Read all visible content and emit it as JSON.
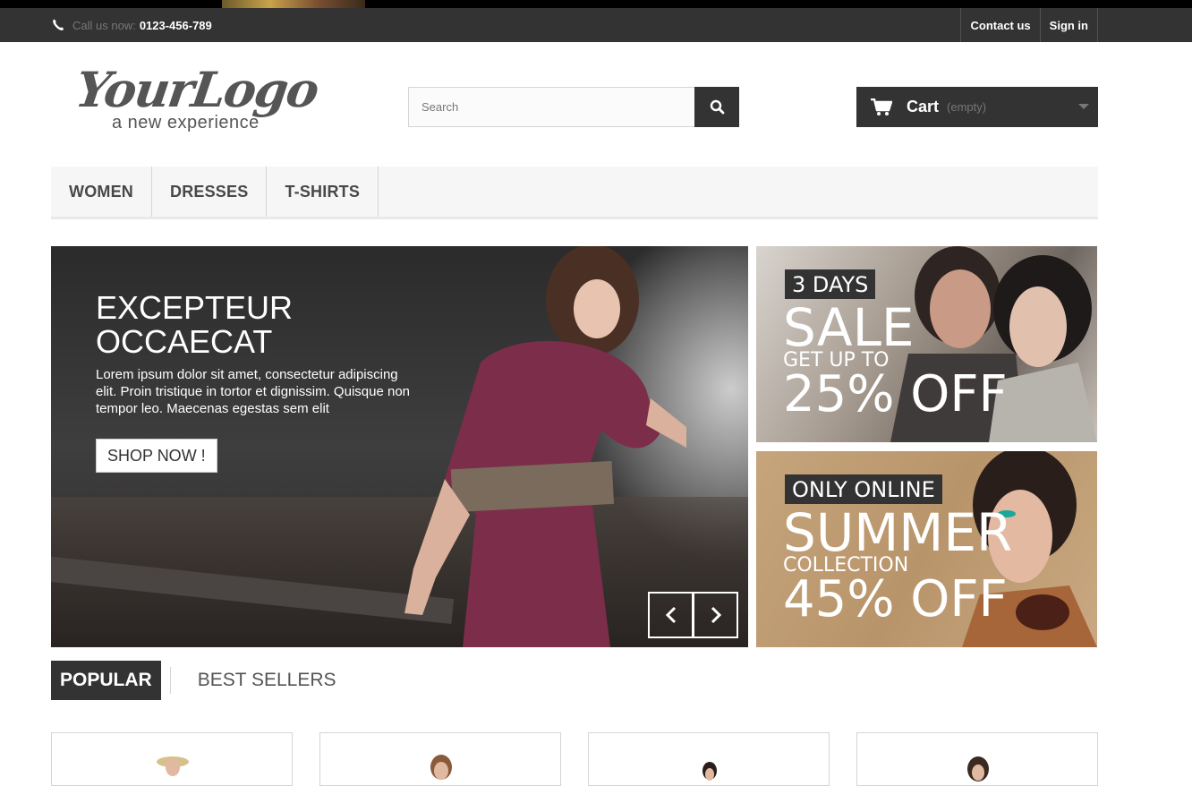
{
  "topbar": {
    "call_label": "Call us now:",
    "phone": "0123-456-789",
    "links": [
      "Contact us",
      "Sign in"
    ]
  },
  "logo": {
    "script": "YourLogo",
    "tagline": "a new experience"
  },
  "search": {
    "placeholder": "Search"
  },
  "cart": {
    "label": "Cart",
    "status": "(empty)"
  },
  "menu": {
    "items": [
      "WOMEN",
      "DRESSES",
      "T-SHIRTS"
    ]
  },
  "slider": {
    "title_line1": "EXCEPTEUR",
    "title_line2": "OCCAECAT",
    "text": "Lorem ipsum dolor sit amet, consectetur adipiscing elit. Proin tristique in tortor et dignissim. Quisque non tempor leo. Maecenas egestas sem elit",
    "button": "SHOP NOW !"
  },
  "promos": [
    {
      "tag": "3 DAYS",
      "big": "SALE",
      "mid": "GET UP TO",
      "off": "25% OFF"
    },
    {
      "tag": "ONLY ONLINE",
      "big": "SUMMER",
      "mid": "COLLECTION",
      "off": "45% OFF"
    }
  ],
  "tabs": {
    "popular": "POPULAR",
    "best": "BEST SELLERS"
  },
  "colors": {
    "dark": "#333333",
    "menu_bg": "#f6f6f6",
    "border": "#d6d4d4"
  }
}
